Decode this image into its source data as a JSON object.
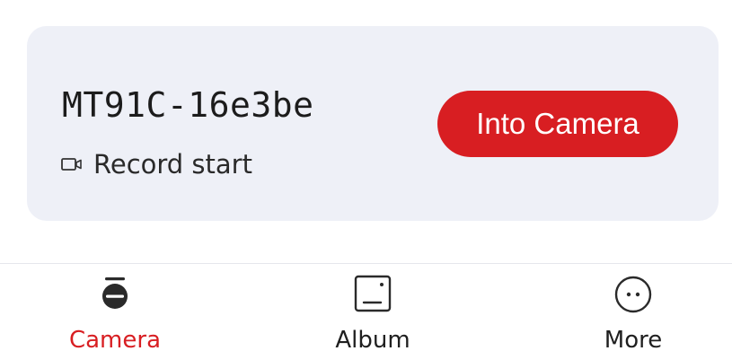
{
  "device": {
    "name": "MT91C-16e3be",
    "status": "Record start",
    "status_icon": "video-camera-icon",
    "button_label": "Into Camera"
  },
  "nav": {
    "items": [
      {
        "label": "Camera",
        "icon": "dashcam-icon",
        "active": true
      },
      {
        "label": "Album",
        "icon": "album-icon",
        "active": false
      },
      {
        "label": "More",
        "icon": "more-icon",
        "active": false
      }
    ]
  },
  "colors": {
    "accent": "#d81e22",
    "card_background": "#eef0f7"
  }
}
